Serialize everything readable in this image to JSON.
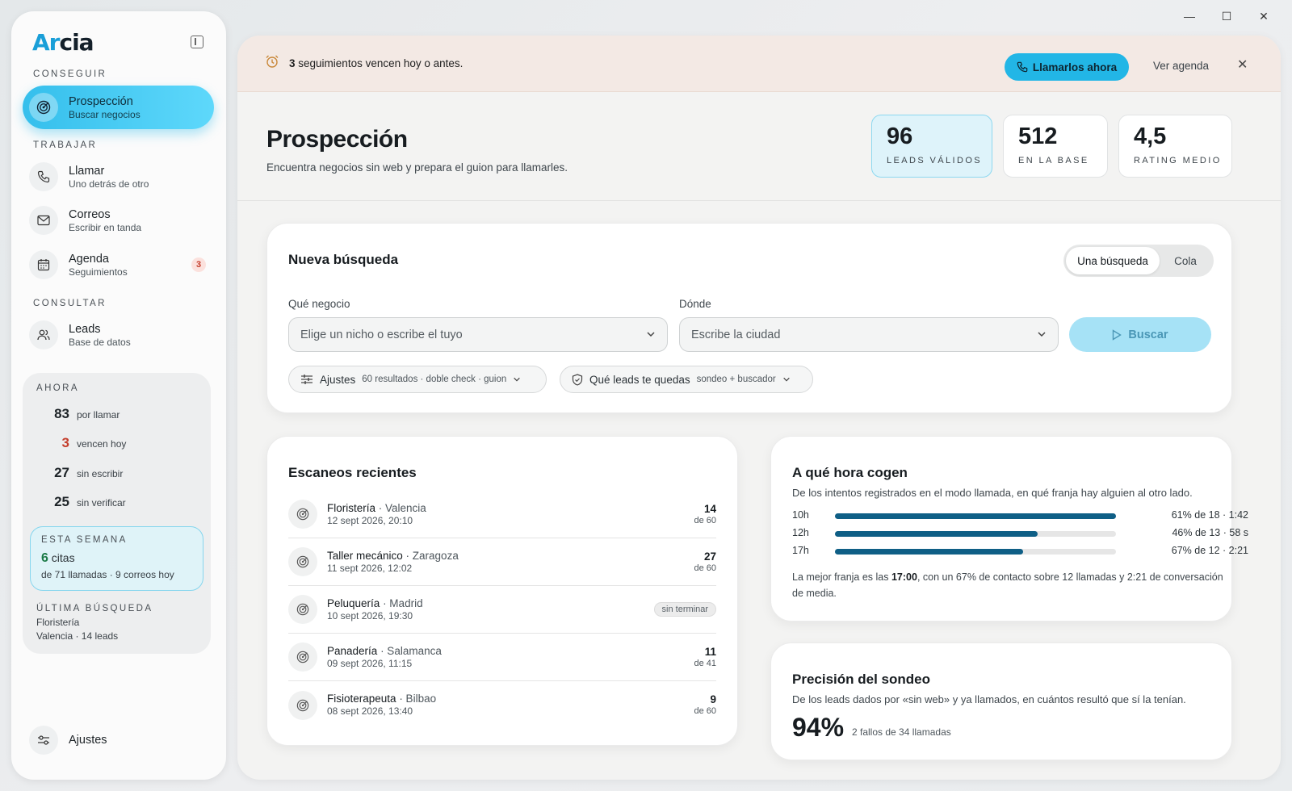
{
  "window": {
    "min": "—",
    "max": "☐",
    "close": "✕"
  },
  "brand": {
    "name_a": "Ar",
    "name_b": "cia"
  },
  "sidebar": {
    "sections": {
      "get": "CONSEGUIR",
      "work": "TRABAJAR",
      "consult": "CONSULTAR"
    },
    "items": [
      {
        "label": "Prospección",
        "sub": "Buscar negocios",
        "active": true
      },
      {
        "label": "Llamar",
        "sub": "Uno detrás de otro"
      },
      {
        "label": "Correos",
        "sub": "Escribir en tanda"
      },
      {
        "label": "Agenda",
        "sub": "Seguimientos",
        "badge": "3"
      },
      {
        "label": "Leads",
        "sub": "Base de datos"
      }
    ],
    "now": {
      "title": "AHORA",
      "stats": [
        {
          "n": "83",
          "l": "por llamar"
        },
        {
          "n": "3",
          "l": "vencen hoy"
        },
        {
          "n": "27",
          "l": "sin escribir"
        },
        {
          "n": "25",
          "l": "sin verificar"
        }
      ],
      "week": {
        "title": "ESTA SEMANA",
        "value": "6",
        "unit": "citas",
        "detail": "de 71 llamadas · 9 correos hoy"
      },
      "last": {
        "title": "ÚLTIMA BÚSQUEDA",
        "line1": "Floristería",
        "line2": "Valencia · 14 leads"
      }
    },
    "settings": "Ajustes"
  },
  "banner": {
    "count": "3",
    "text": "seguimientos vencen hoy o antes.",
    "cta": "Llamarlos ahora",
    "link": "Ver agenda"
  },
  "header": {
    "title": "Prospección",
    "subtitle": "Encuentra negocios sin web y prepara el guion para llamarles.",
    "kpis": [
      {
        "value": "96",
        "label": "LEADS VÁLIDOS"
      },
      {
        "value": "512",
        "label": "EN LA BASE"
      },
      {
        "value": "4,5",
        "label": "RATING MEDIO"
      }
    ]
  },
  "search": {
    "title": "Nueva búsqueda",
    "modes": [
      "Una búsqueda",
      "Cola"
    ],
    "what_label": "Qué negocio",
    "what_placeholder": "Elige un nicho o escribe el tuyo",
    "where_label": "Dónde",
    "where_placeholder": "Escribe la ciudad",
    "submit": "Buscar",
    "chips": [
      {
        "label": "Ajustes",
        "detail": "60 resultados · doble check · guion"
      },
      {
        "label": "Qué leads te quedas",
        "detail": "sondeo + buscador"
      }
    ]
  },
  "recent": {
    "title": "Escaneos recientes",
    "rows": [
      {
        "niche": "Floristería",
        "city": " · Valencia",
        "date": "12 sept 2026, 20:10",
        "n": "14",
        "of": "de 60"
      },
      {
        "niche": "Taller mecánico",
        "city": " · Zaragoza",
        "date": "11 sept 2026, 12:02",
        "n": "27",
        "of": "de 60"
      },
      {
        "niche": "Peluquería",
        "city": " · Madrid",
        "date": "10 sept 2026, 19:30",
        "tag": "sin terminar"
      },
      {
        "niche": "Panadería",
        "city": " · Salamanca",
        "date": "09 sept 2026, 11:15",
        "n": "11",
        "of": "de 41"
      },
      {
        "niche": "Fisioterapeuta",
        "city": " · Bilbao",
        "date": "08 sept 2026, 13:40",
        "n": "9",
        "of": "de 60"
      }
    ]
  },
  "hours": {
    "title": "A qué hora cogen",
    "subtitle": "De los intentos registrados en el modo llamada, en qué franja hay alguien al otro lado.",
    "rows": [
      {
        "h": "10h",
        "stat": "61% de 18 · 1:42",
        "pct": 100
      },
      {
        "h": "12h",
        "stat": "46% de 13 · 58 s",
        "pct": 72
      },
      {
        "h": "17h",
        "stat": "67% de 12 · 2:21",
        "pct": 67
      }
    ],
    "note_a": "La mejor franja es las ",
    "note_b": "17:00",
    "note_c": ", con un 67% de contacto sobre 12 llamadas y 2:21 de conversación de media."
  },
  "accuracy": {
    "title": "Precisión del sondeo",
    "subtitle": "De los leads dados por «sin web» y ya llamados, en cuántos resultó que sí la tenían.",
    "value": "94%",
    "detail": "2 fallos de 34 llamadas"
  }
}
